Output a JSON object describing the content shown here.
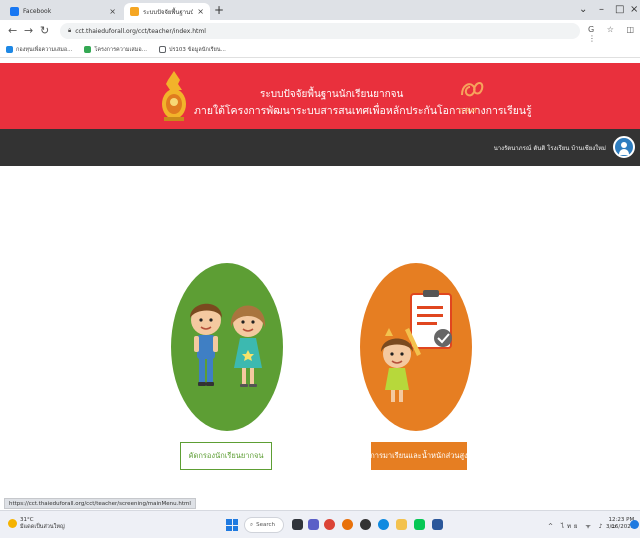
{
  "browser": {
    "tabs": [
      {
        "title": "Facebook",
        "favicon_color": "#1877f2",
        "active": false
      },
      {
        "title": "ระบบปัจจัยพื้นฐานนักเรียนยากจน",
        "favicon_color": "#f5a623",
        "active": true
      }
    ],
    "new_tab_symbol": "+",
    "url": "cct.thaieduforall.org/cct/teacher/index.html",
    "bookmarks": [
      {
        "label": "กองทุนเพื่อความเสมอ...",
        "icon_color": "#1e88e5"
      },
      {
        "label": "โครงการความเสมอ...",
        "icon_color": "#34a853"
      },
      {
        "label": "ปร103 ข้อมูลนักเรียน...",
        "icon_color": "#5f6368"
      }
    ],
    "status_url": "https://cct.thaieduforall.org/cct/teacher/screening/mainMenu.html"
  },
  "site": {
    "title_line1": "ระบบปัจจัยพื้นฐานนักเรียนยากจน",
    "title_line2": "ภายใต้โครงการพัฒนาระบบสารสนเทศเพื่อหลักประกันโอกาสทางการเรียนรู้",
    "partner_logo_text": "กสศ",
    "user_name": "นางรัตนาภรณ์ ตันติ โรงเรียน บ้านเชียงใหม่"
  },
  "menu": [
    {
      "label": "คัดกรองนักเรียนยากจน",
      "color": "#5d9e34"
    },
    {
      "label": "การมาเรียนและน้ำหนักส่วนสูง",
      "color": "#e67e22"
    }
  ],
  "taskbar": {
    "weather_temp": "31°C",
    "weather_desc": "มีแดดเป็นส่วนใหญ่",
    "search_label": "Search",
    "tray_lang": "ไทย",
    "time": "12:23 PM",
    "date": "3/16/2023"
  }
}
